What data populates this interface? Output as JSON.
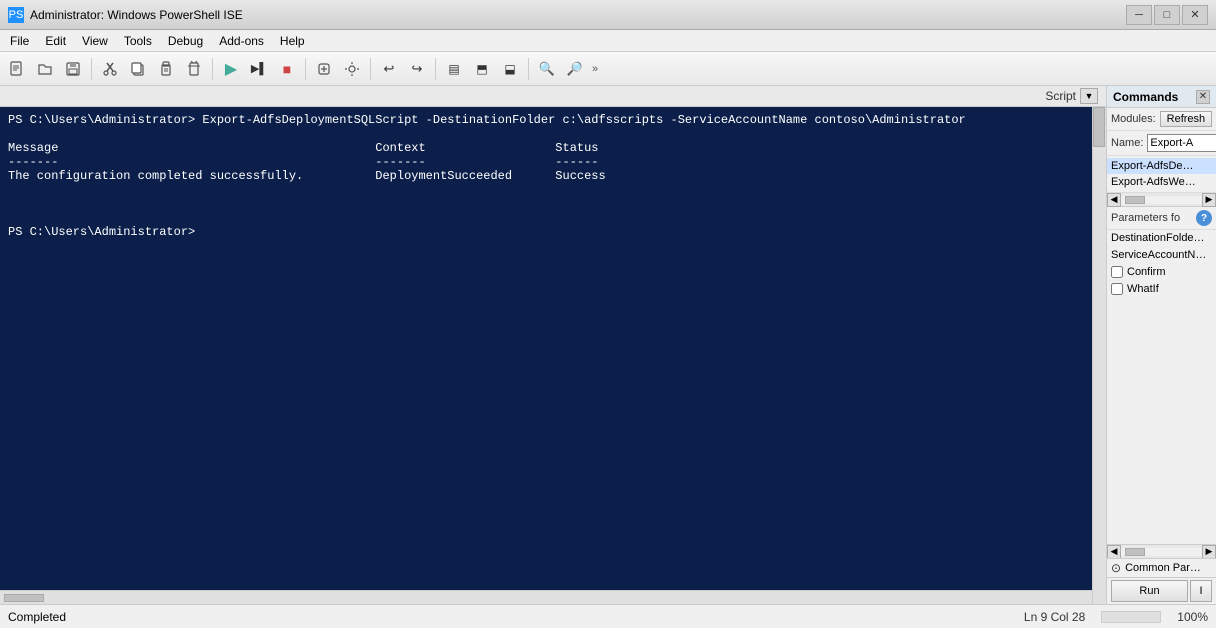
{
  "titleBar": {
    "title": "Administrator: Windows PowerShell ISE",
    "icon": "PS",
    "minimizeLabel": "─",
    "maximizeLabel": "□",
    "closeLabel": "✕"
  },
  "menuBar": {
    "items": [
      "File",
      "Edit",
      "View",
      "Tools",
      "Debug",
      "Add-ons",
      "Help"
    ]
  },
  "toolbar": {
    "buttons": [
      {
        "name": "new-file-btn",
        "icon": "📄"
      },
      {
        "name": "open-file-btn",
        "icon": "📂"
      },
      {
        "name": "save-btn",
        "icon": "💾"
      },
      {
        "name": "cut-btn",
        "icon": "✂"
      },
      {
        "name": "copy-btn",
        "icon": "📋"
      },
      {
        "name": "paste-btn",
        "icon": "📌"
      },
      {
        "name": "clear-btn",
        "icon": "🗑"
      },
      {
        "name": "run-script-btn",
        "icon": "▶"
      },
      {
        "name": "run-selection-btn",
        "icon": "▶▶"
      },
      {
        "name": "stop-btn",
        "icon": "■"
      },
      {
        "name": "debug-btn",
        "icon": "🔧"
      },
      {
        "name": "breakpoint-btn",
        "icon": "⚙"
      },
      {
        "name": "undo-btn",
        "icon": "↩"
      },
      {
        "name": "redo-btn",
        "icon": "↪"
      },
      {
        "name": "show-console-btn",
        "icon": "▤"
      },
      {
        "name": "split-horizontal-btn",
        "icon": "⬒"
      },
      {
        "name": "split-vertical-btn",
        "icon": "⬓"
      },
      {
        "name": "zoom-in-btn",
        "icon": "🔍"
      },
      {
        "name": "zoom-out-btn",
        "icon": "🔎"
      }
    ]
  },
  "scriptBar": {
    "label": "Script"
  },
  "console": {
    "lines": [
      "PS C:\\Users\\Administrator> Export-AdfsDeploymentSQLScript -DestinationFolder c:\\adfsscripts -ServiceAccountName contoso\\Administrator",
      "",
      "Message                                            Context                  Status",
      "-------                                            -------                  ------",
      "The configuration completed successfully.          DeploymentSucceeded      Success",
      "",
      "",
      "",
      "PS C:\\Users\\Administrator> "
    ]
  },
  "commandsPanel": {
    "title": "Commands",
    "closeLabel": "✕",
    "modulesLabel": "Modules:",
    "refreshLabel": "Refresh",
    "nameLabel": "Name:",
    "nameValue": "Export-A",
    "listItems": [
      {
        "label": "Export-AdfsDe…",
        "selected": true
      },
      {
        "label": "Export-AdfsWe…",
        "selected": false
      }
    ],
    "paramsLabel": "Parameters fo",
    "helpLabel": "?",
    "params": [
      {
        "label": "DestinationFolde…"
      },
      {
        "label": "ServiceAccountN…"
      }
    ],
    "checkboxes": [
      {
        "label": "Confirm",
        "checked": false
      },
      {
        "label": "WhatIf",
        "checked": false
      }
    ],
    "commonParamsLabel": "Common Par…",
    "runLabel": "Run",
    "runExtraLabel": "I"
  },
  "statusBar": {
    "statusText": "Completed",
    "position": "Ln 9  Col 28",
    "scrollIndicator": "",
    "zoom": "100%"
  }
}
